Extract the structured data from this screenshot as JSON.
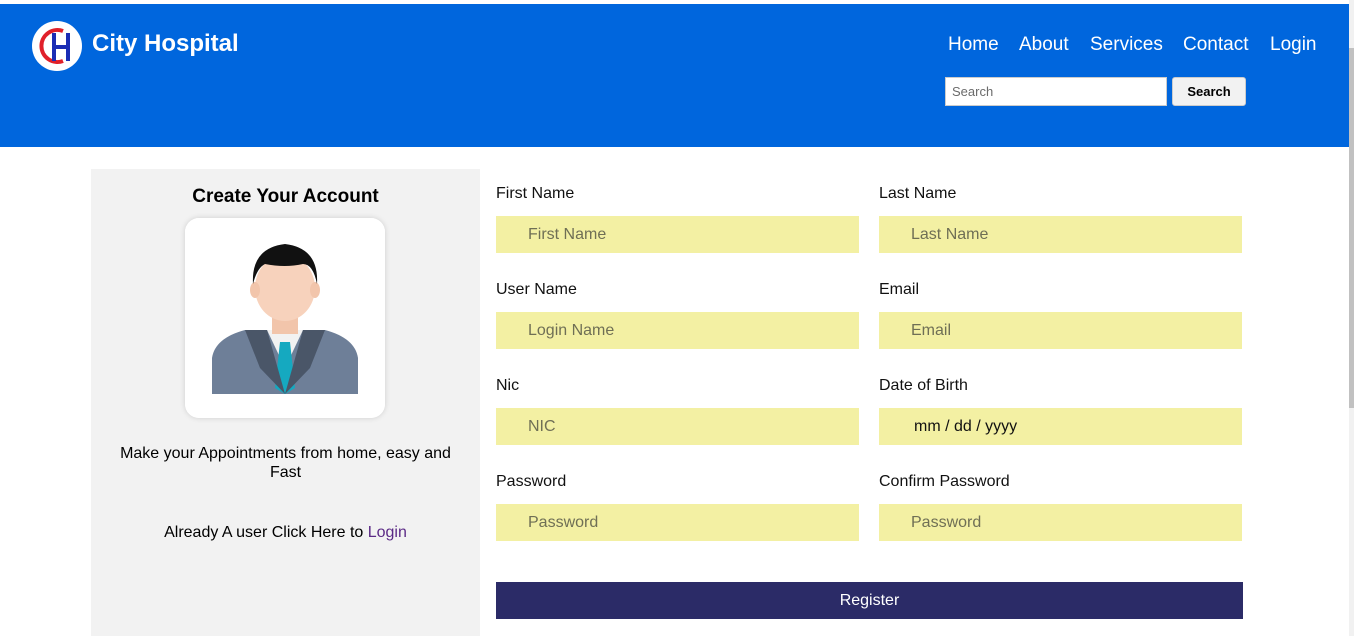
{
  "brand": {
    "name": "City Hospital"
  },
  "nav": [
    "Home",
    "About",
    "Services",
    "Contact",
    "Login"
  ],
  "search": {
    "placeholder": "Search",
    "button_label": "Search"
  },
  "panel": {
    "title": "Create Your Account",
    "tagline": "Make your Appointments from home, easy and Fast",
    "login_prefix": "Already A user Click Here to ",
    "login_link": "Login"
  },
  "form": {
    "first_name": {
      "label": "First Name",
      "placeholder": "First Name"
    },
    "last_name": {
      "label": "Last Name",
      "placeholder": "Last Name"
    },
    "user_name": {
      "label": "User Name",
      "placeholder": "Login Name"
    },
    "email": {
      "label": "Email",
      "placeholder": "Email"
    },
    "nic": {
      "label": "Nic",
      "placeholder": "NIC"
    },
    "dob": {
      "label": "Date of Birth",
      "value": "mm / dd / yyyy"
    },
    "password": {
      "label": "Password",
      "placeholder": "Password"
    },
    "confirm_password": {
      "label": "Confirm Password",
      "placeholder": "Password"
    },
    "register_label": "Register"
  },
  "colors": {
    "header": "#0066dd",
    "input_bg": "#f3f0a3",
    "register_bg": "#2b2b67",
    "panel_bg": "#f2f2f2",
    "link": "#5b2a86"
  },
  "icons": {
    "logo": "city-hospital-logo",
    "avatar": "user-avatar-illustration"
  }
}
